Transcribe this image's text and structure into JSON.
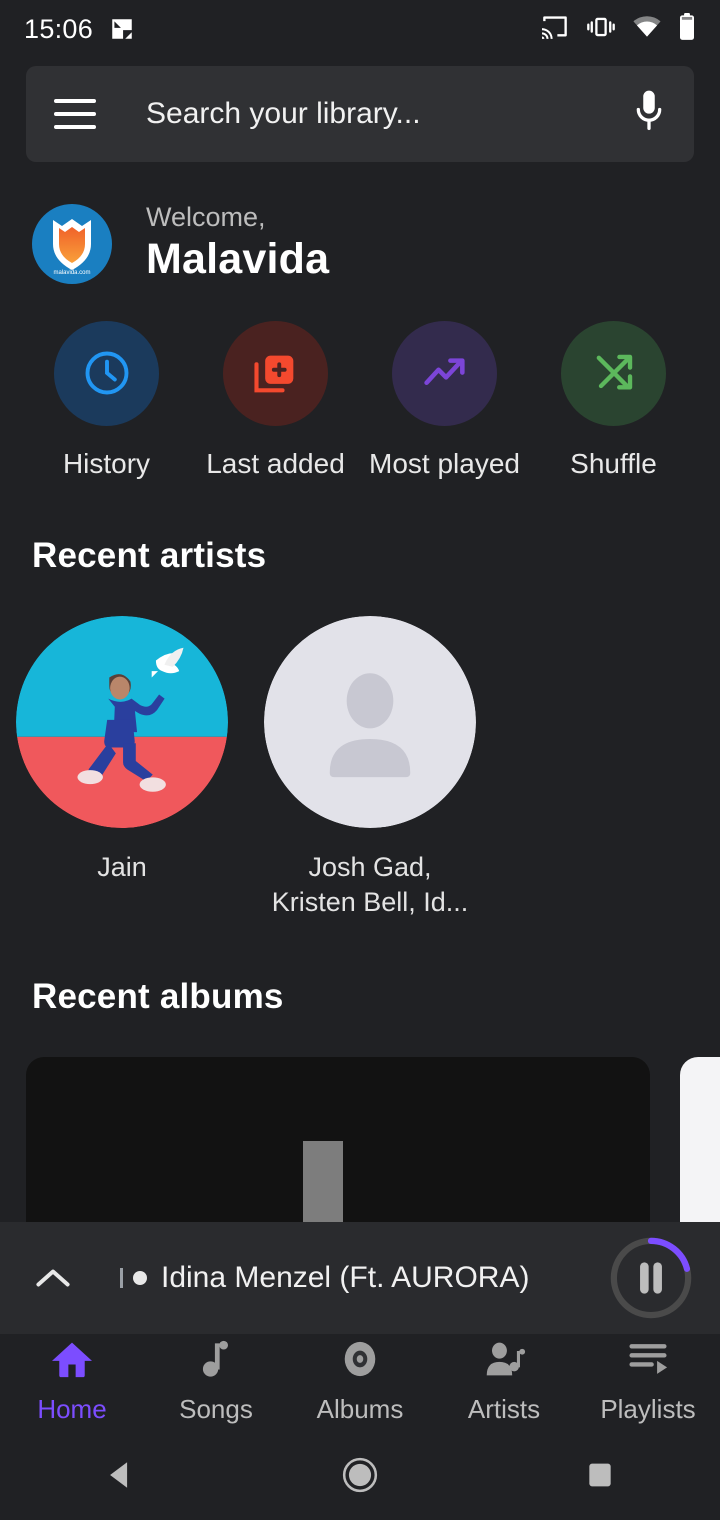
{
  "statusbar": {
    "time": "15:06",
    "notification_icon": "screenshot-notification-icon",
    "cast_icon": "cast-icon",
    "vibrate_icon": "vibrate-icon",
    "wifi_icon": "wifi-icon",
    "battery_icon": "battery-icon"
  },
  "search": {
    "menu_icon": "hamburger-menu-icon",
    "placeholder": "Search your library...",
    "mic_icon": "microphone-icon"
  },
  "welcome": {
    "greeting": "Welcome,",
    "name": "Malavida",
    "logo_caption": "malavida.com"
  },
  "quick_actions": [
    {
      "label": "History",
      "icon": "clock-icon",
      "circle_color": "#1b3a5c",
      "icon_color": "#2196f3"
    },
    {
      "label": "Last added",
      "icon": "library-add-icon",
      "circle_color": "#4a2220",
      "icon_color": "#f4492e"
    },
    {
      "label": "Most played",
      "icon": "trending-up-icon",
      "circle_color": "#332b4d",
      "icon_color": "#7c45d8"
    },
    {
      "label": "Shuffle",
      "icon": "shuffle-icon",
      "circle_color": "#2a4430",
      "icon_color": "#5cb85c"
    }
  ],
  "sections": {
    "recent_artists_title": "Recent artists",
    "recent_albums_title": "Recent albums"
  },
  "artists": [
    {
      "name": "Jain",
      "art": "jain-album-art"
    },
    {
      "name": "Josh Gad,\nKristen Bell, Id...",
      "art": "person-placeholder-avatar"
    }
  ],
  "albums": [
    {
      "art": "music-note-placeholder",
      "background": "#121212"
    },
    {
      "art": "album-art-white",
      "background": "#f4f4f6"
    }
  ],
  "player": {
    "expand_icon": "chevron-up-icon",
    "track_title": "Idina Menzel (Ft. AURORA)",
    "pause_icon": "pause-icon",
    "progress_color": "#7c4dff",
    "progress_track_color": "#4a4a4a",
    "progress_percent": 21
  },
  "bottom_nav": {
    "active_color": "#7c4dff",
    "inactive_color": "#9e9e9e",
    "items": [
      {
        "label": "Home",
        "icon": "home-icon",
        "active": true
      },
      {
        "label": "Songs",
        "icon": "music-note-icon",
        "active": false
      },
      {
        "label": "Albums",
        "icon": "album-disc-icon",
        "active": false
      },
      {
        "label": "Artists",
        "icon": "artist-icon",
        "active": false
      },
      {
        "label": "Playlists",
        "icon": "playlist-icon",
        "active": false
      }
    ]
  },
  "android_nav": {
    "back_icon": "back-triangle-icon",
    "home_icon": "home-circle-icon",
    "recents_icon": "recents-square-icon"
  }
}
